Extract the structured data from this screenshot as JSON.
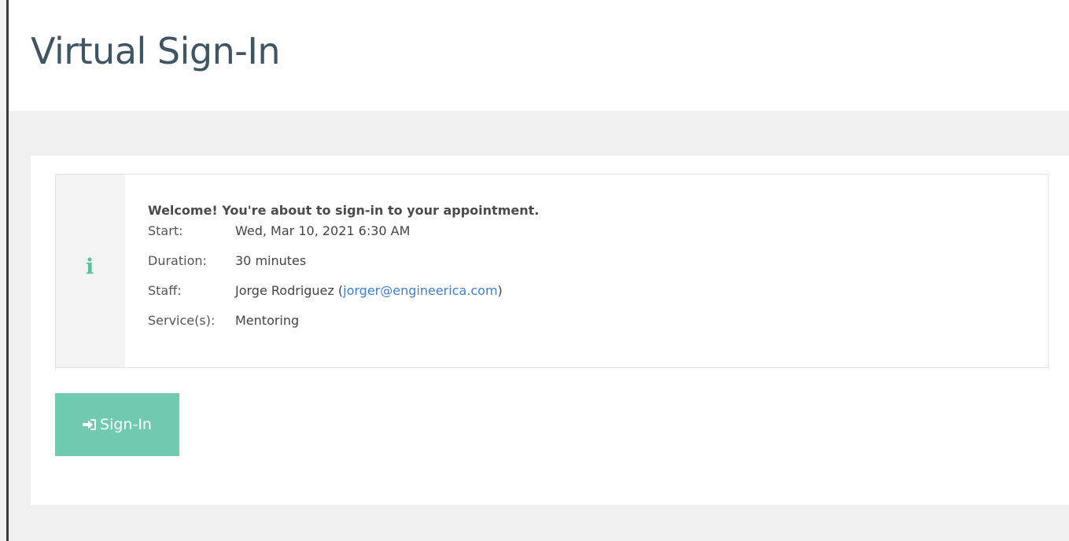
{
  "page": {
    "title": "Virtual Sign-In"
  },
  "appointment": {
    "welcome": "Welcome! You're about to sign-in to your appointment.",
    "info_icon": "info-icon",
    "start_label": "Start:",
    "start_value": "Wed, Mar 10, 2021 6:30 AM",
    "duration_label": "Duration:",
    "duration_value": "30 minutes",
    "staff_label": "Staff:",
    "staff_name": "Jorge Rodriguez",
    "staff_open_paren": "(",
    "staff_email": "jorger@engineerica.com",
    "staff_close_paren": ")",
    "services_label": "Service(s):",
    "services_value": "Mentoring"
  },
  "actions": {
    "signin_label": "Sign-In",
    "signin_icon": "sign-in-icon"
  },
  "colors": {
    "accent": "#6fcab0",
    "info_icon": "#5bbf9f",
    "title": "#3e5566",
    "link": "#3d7fd6"
  }
}
